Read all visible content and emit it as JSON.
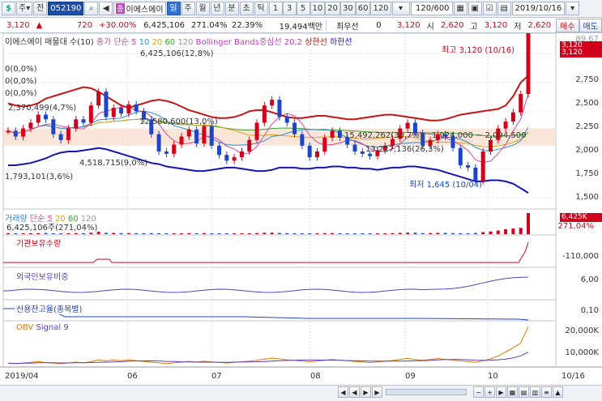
{
  "toolbar": {
    "main_mode": "주",
    "prev_label": "전",
    "stock_code": "052190",
    "stock_badge": "종",
    "stock_name": "이에스에이",
    "periods": [
      "일",
      "주",
      "월",
      "년",
      "분",
      "초",
      "틱"
    ],
    "active_period": "일",
    "intervals": [
      "1",
      "3",
      "5",
      "10",
      "20",
      "30",
      "60",
      "120"
    ],
    "count_value": "120/600",
    "date_value": "2019/10/16",
    "buy_label": "매수",
    "sell_label": "매도"
  },
  "info": {
    "price": "3,120",
    "change": "720",
    "change_pct": "+30.00%",
    "volume": "6,425,106",
    "volume_pct": "271.04%",
    "turnover": "22.39%",
    "amount": "19,494백만",
    "pref_label": "최우선",
    "pref_value": "0",
    "last_price": "3,120",
    "open_label": "시",
    "open_value": "2,620",
    "high_label": "고",
    "high_value": "3,120",
    "low_label": "저",
    "low_value": "2,620"
  },
  "price_panel": {
    "legend_title": "이에스에이 매물대 수(10)",
    "legend_ma": "종가 단순 5",
    "ma_periods": [
      "10",
      "20",
      "60",
      "120"
    ],
    "legend_bb": "Bollinger Bands중심선 20,2",
    "legend_upper": "상한선",
    "legend_lower": "하한선",
    "price_tag_1": "3,120",
    "price_tag_2": "3,120",
    "y_ticks": [
      "2,750",
      "2,500",
      "2,250",
      "2,000",
      "1,750",
      "1,500"
    ],
    "y_top": "89.67",
    "max_label": "최고 3,120 (10/16)",
    "min_label": "최저 1,645 (10/04)",
    "zero_labels": [
      "0(0,0%)",
      "0(0,0%)",
      "0(0,0%)"
    ],
    "vp_labels": [
      "6,425,106(12,8%)",
      "2,370,499(4,7%)",
      "12,580,600(13,0%)",
      "4,518,715(9,0%)",
      "1,793,101(3,6%)",
      "15,492,262(30,7%)",
      "13,227,136(26,3%)",
      "1,924,000 ~ 2,094,500"
    ]
  },
  "volume_panel": {
    "legend_title": "거래량",
    "legend_ma": "단순 5",
    "ma_periods": [
      "20",
      "60",
      "120"
    ],
    "value_label": "6,425,106주(271,04%)",
    "tag_1": "6,425K",
    "tag_2": "271,04%"
  },
  "inst_panel": {
    "legend": "기관보유수량",
    "y_tick": "-110,000"
  },
  "foreign_panel": {
    "legend": "외국인보유비중",
    "y_tick": "6,00"
  },
  "credit_panel": {
    "legend": "신용잔고율(종목별)",
    "y_tick": "0,10"
  },
  "obv_panel": {
    "legend_title": "OBV",
    "legend_signal": "Signal 9",
    "y_ticks": [
      "20,000K",
      "10,000K"
    ]
  },
  "x_axis": {
    "labels": [
      "2019/04",
      "06",
      "07",
      "08",
      "09",
      "10",
      "10/16"
    ]
  },
  "colors": {
    "up": "#d0021b",
    "down": "#1e44c8",
    "bb_upper": "#c41414",
    "bb_lower": "#1414b0",
    "ma5": "#d6479b",
    "ma10": "#2d8bd6",
    "ma20": "#d8a419",
    "ma60": "#35a836",
    "ma120": "#999999"
  },
  "chart_data": [
    {
      "type": "line",
      "title": "",
      "series": [
        {
          "name": "종가",
          "values": [
            2080,
            2030,
            2100,
            2150,
            2220,
            2180,
            2050,
            2000,
            2100,
            2180,
            2150,
            2300,
            2420,
            2200,
            2280,
            2230,
            2310,
            2250,
            2180,
            2050,
            1900,
            1880,
            1960,
            2030,
            2090,
            1970,
            2120,
            1950,
            1870,
            1820,
            1850,
            1900,
            2000,
            2150,
            2300,
            2350,
            2200,
            2150,
            2050,
            1950,
            1850,
            1900,
            2020,
            2080,
            2020,
            1960,
            1900,
            1880,
            1860,
            1910,
            1950,
            2010,
            2100,
            2150,
            2060,
            1950,
            2000,
            2050,
            2030,
            1930,
            1780,
            1760,
            1645,
            1900,
            2000,
            2100,
            2160,
            2240,
            2400,
            3120
          ]
        },
        {
          "name": "상한선",
          "values": [
            2320,
            2300,
            2290,
            2300,
            2320,
            2360,
            2380,
            2400,
            2420,
            2440,
            2460,
            2450,
            2420,
            2380,
            2340,
            2300,
            2280,
            2300,
            2320,
            2340,
            2350,
            2340,
            2320,
            2290,
            2260,
            2240,
            2220,
            2200,
            2190,
            2190,
            2200,
            2220,
            2250,
            2260,
            2260,
            2240,
            2220,
            2200,
            2190,
            2190,
            2200,
            2210,
            2210,
            2200,
            2190,
            2180,
            2180,
            2190,
            2200,
            2210,
            2220,
            2220,
            2210,
            2200,
            2190,
            2180,
            2170,
            2170,
            2180,
            2200,
            2220,
            2230,
            2240,
            2250,
            2260,
            2270,
            2300,
            2380,
            2500,
            2560
          ]
        },
        {
          "name": "하한선",
          "values": [
            1780,
            1780,
            1790,
            1800,
            1820,
            1840,
            1870,
            1890,
            1900,
            1900,
            1910,
            1920,
            1930,
            1920,
            1900,
            1880,
            1860,
            1840,
            1820,
            1800,
            1790,
            1770,
            1760,
            1750,
            1740,
            1730,
            1730,
            1740,
            1750,
            1760,
            1760,
            1750,
            1740,
            1730,
            1730,
            1740,
            1760,
            1760,
            1760,
            1750,
            1750,
            1760,
            1760,
            1770,
            1770,
            1760,
            1760,
            1750,
            1750,
            1740,
            1750,
            1760,
            1760,
            1770,
            1770,
            1760,
            1750,
            1740,
            1720,
            1700,
            1680,
            1660,
            1640,
            1640,
            1650,
            1650,
            1640,
            1620,
            1580,
            1540
          ]
        }
      ],
      "ylim": [
        1400,
        2900
      ],
      "xlabel": "",
      "ylabel": ""
    },
    {
      "type": "bar",
      "title": "",
      "series": [
        {
          "name": "거래량",
          "values": [
            300,
            250,
            280,
            260,
            300,
            350,
            260,
            220,
            300,
            330,
            280,
            420,
            700,
            380,
            360,
            300,
            330,
            300,
            280,
            300,
            260,
            240,
            250,
            260,
            300,
            250,
            330,
            260,
            240,
            220,
            230,
            240,
            260,
            330,
            420,
            450,
            350,
            300,
            280,
            260,
            240,
            260,
            300,
            330,
            280,
            260,
            240,
            230,
            220,
            250,
            260,
            300,
            380,
            450,
            420,
            300,
            330,
            380,
            360,
            300,
            280,
            250,
            350,
            600,
            800,
            1100,
            1500,
            1700,
            1900,
            6425
          ]
        }
      ],
      "xlabel": "",
      "ylabel": ""
    }
  ]
}
